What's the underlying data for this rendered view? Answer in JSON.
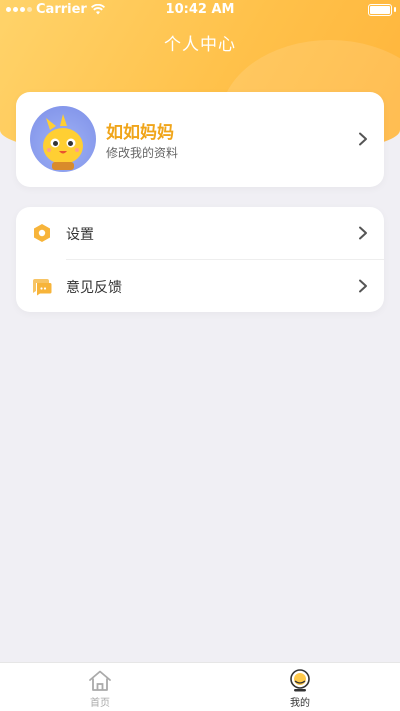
{
  "status_bar": {
    "carrier": "Carrier",
    "time": "10:42 AM"
  },
  "header": {
    "title": "个人中心"
  },
  "profile": {
    "name": "如如妈妈",
    "subtitle": "修改我的资料",
    "avatar_icon": "cartoon-chick-avatar"
  },
  "menu": {
    "items": [
      {
        "label": "设置",
        "icon": "settings-hexagon-icon"
      },
      {
        "label": "意见反馈",
        "icon": "feedback-chat-icon"
      }
    ]
  },
  "tabbar": {
    "tabs": [
      {
        "label": "首页",
        "icon": "home-icon",
        "active": false
      },
      {
        "label": "我的",
        "icon": "profile-icon",
        "active": true
      }
    ]
  },
  "colors": {
    "accent": "#ffb43a",
    "name_text": "#f0a51a",
    "background": "#f0eff4"
  }
}
